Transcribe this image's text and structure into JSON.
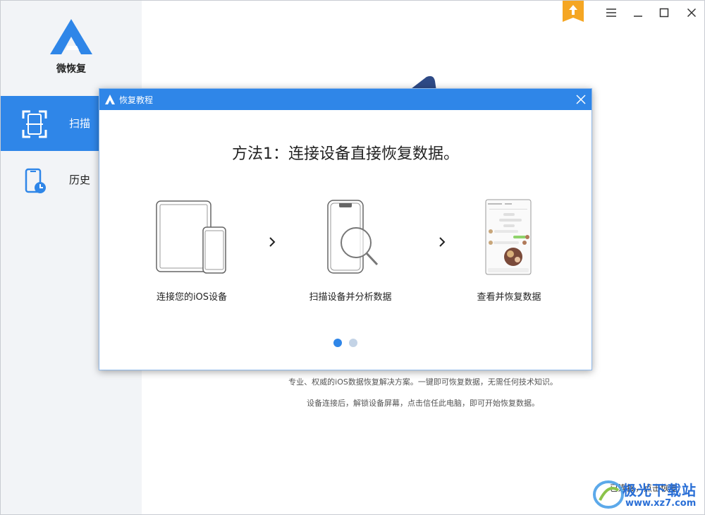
{
  "app": {
    "name": "微恢复"
  },
  "sidebar": {
    "items": [
      {
        "label": "扫描",
        "icon": "scan-icon",
        "active": true
      },
      {
        "label": "历史",
        "icon": "history-icon",
        "active": false
      }
    ]
  },
  "window_controls": {
    "upgrade_icon": "upload-icon",
    "menu_icon": "menu-icon",
    "minimize_icon": "minimize-icon",
    "maximize_icon": "maximize-icon",
    "close_icon": "close-icon"
  },
  "main": {
    "info_line1": "专业、权威的iOS数据恢复解决方案。一键即可恢复数据，无需任何技术知识。",
    "info_line2": "设备连接后，解锁设备屏幕，点击信任此电脑，即可开始恢复数据。"
  },
  "dialog": {
    "title": "恢复教程",
    "heading": "方法1：连接设备直接恢复数据。",
    "steps": [
      {
        "label": "连接您的iOS设备",
        "icon": "devices-icon"
      },
      {
        "label": "扫描设备并分析数据",
        "icon": "phone-search-icon"
      },
      {
        "label": "查看并恢复数据",
        "icon": "phone-chat-icon"
      }
    ],
    "pagination": {
      "total": 2,
      "current": 1
    }
  },
  "watermark": {
    "text": "极光下载站",
    "url": "www.xz7.com",
    "behind_text": "已连接，点击恢复"
  },
  "colors": {
    "accent": "#2f86e8",
    "sidebar_bg": "#f2f4f7",
    "upgrade": "#f5a623",
    "dot_inactive": "#c3d3e6"
  }
}
